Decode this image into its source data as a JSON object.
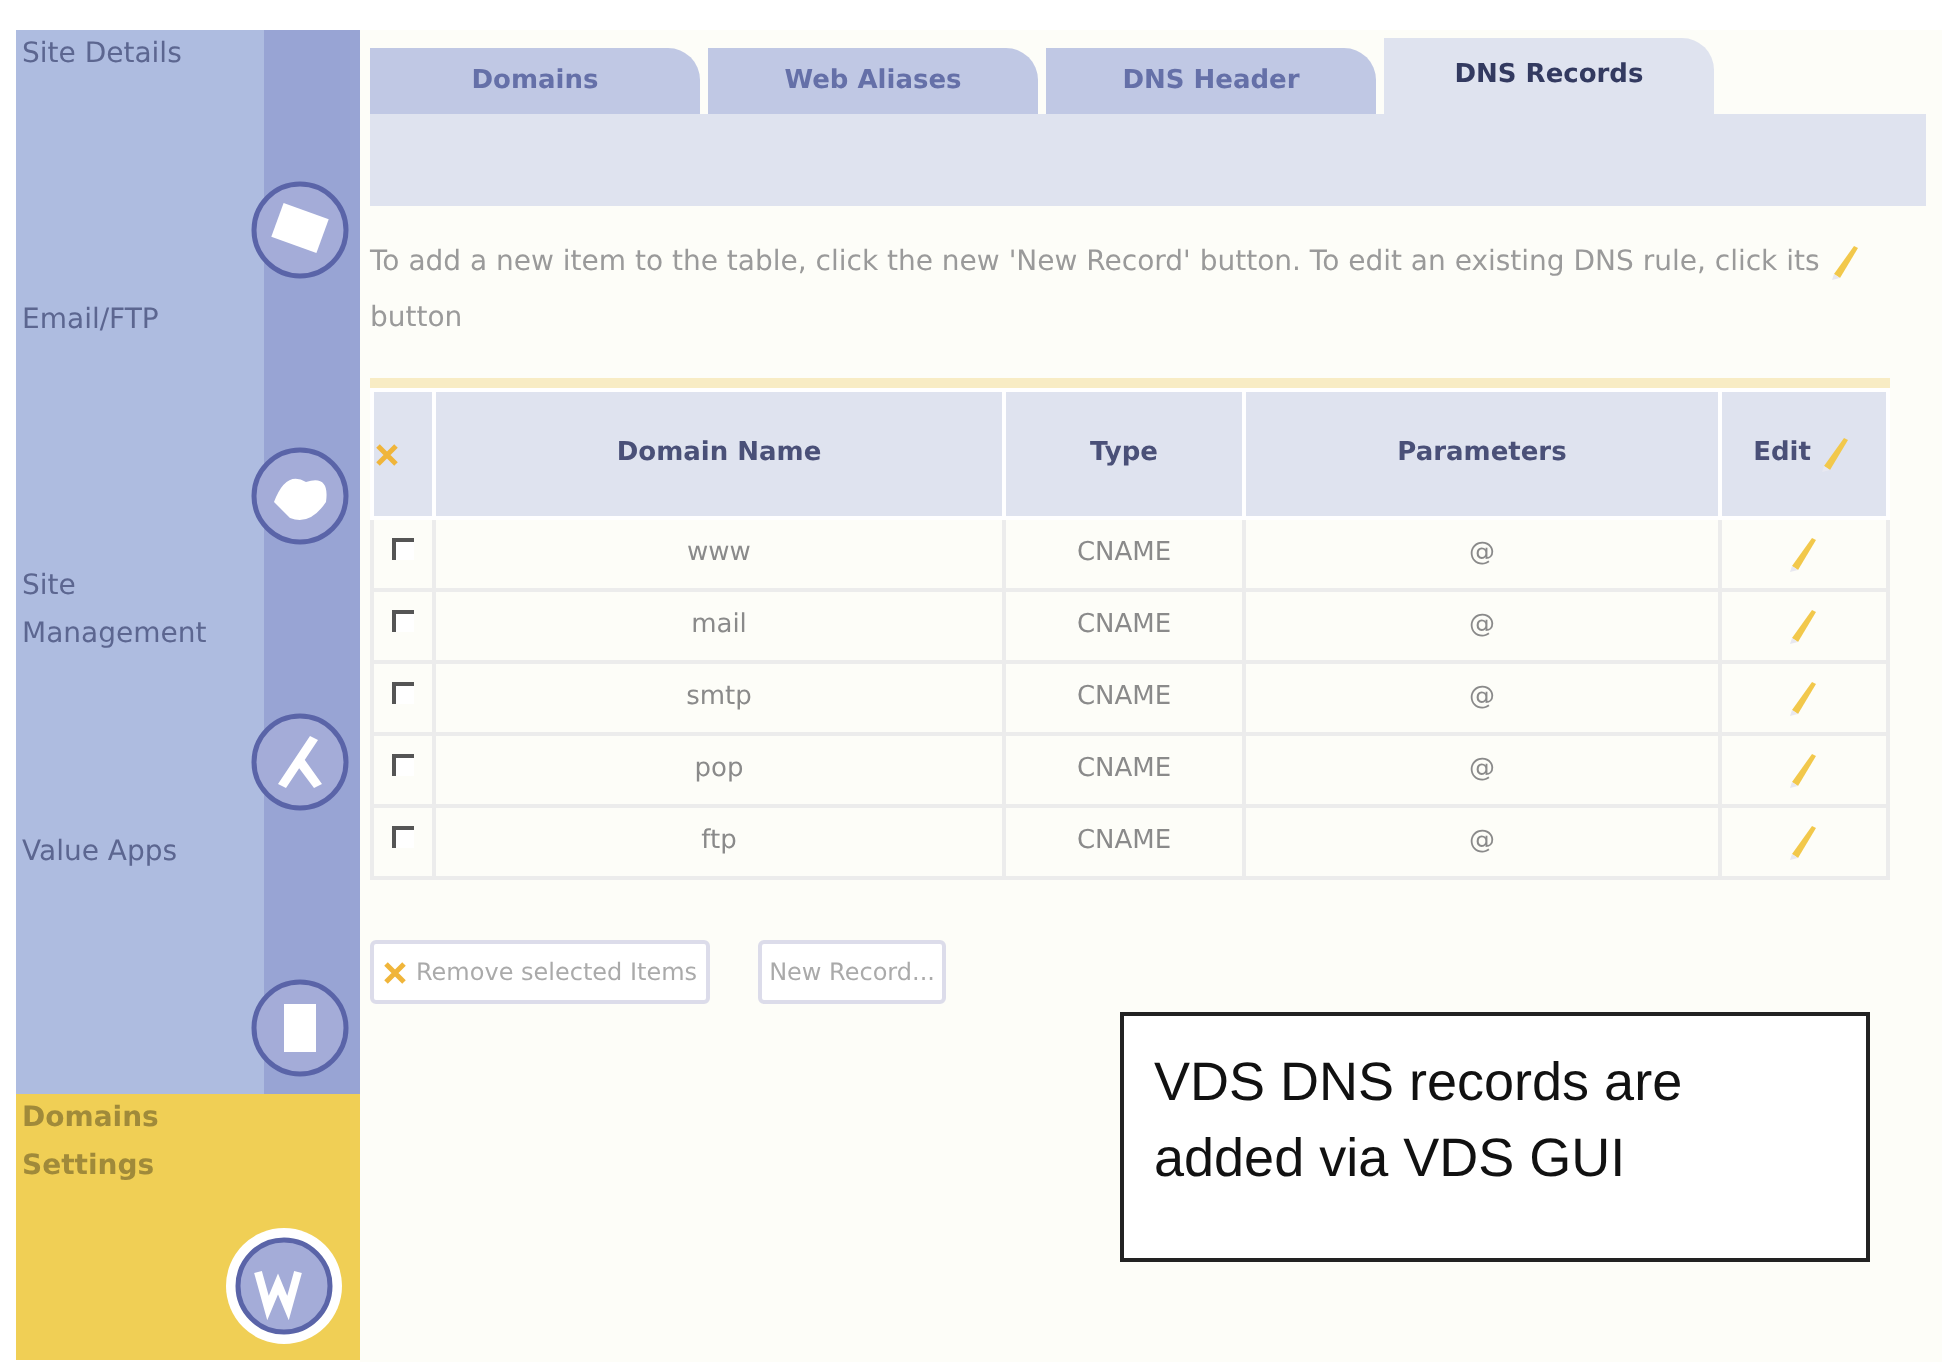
{
  "sidebar": {
    "items": [
      {
        "label": "Site Details",
        "selected": false
      },
      {
        "label": "Email/FTP",
        "selected": false
      },
      {
        "label": "Site Management",
        "selected": false
      },
      {
        "label": "Value Apps",
        "selected": false
      },
      {
        "label": "Domains Settings",
        "selected": true
      }
    ]
  },
  "tabs": [
    {
      "label": "Domains",
      "selected": false
    },
    {
      "label": "Web Aliases",
      "selected": false
    },
    {
      "label": "DNS Header",
      "selected": false
    },
    {
      "label": "DNS Records",
      "selected": true
    }
  ],
  "instructions": {
    "before": "To add a new item to the table, click the new 'New Record' button. To edit an existing DNS rule, click its",
    "after": "button"
  },
  "table": {
    "columns": [
      "Domain Name",
      "Type",
      "Parameters",
      "Edit"
    ],
    "rows": [
      {
        "domain": "www",
        "type": "CNAME",
        "parameters": "@",
        "checked": false
      },
      {
        "domain": "mail",
        "type": "CNAME",
        "parameters": "@",
        "checked": false
      },
      {
        "domain": "smtp",
        "type": "CNAME",
        "parameters": "@",
        "checked": false
      },
      {
        "domain": "pop",
        "type": "CNAME",
        "parameters": "@",
        "checked": false
      },
      {
        "domain": "ftp",
        "type": "CNAME",
        "parameters": "@",
        "checked": false
      }
    ]
  },
  "buttons": {
    "remove": "Remove selected Items",
    "new": "New Record..."
  },
  "callout": "VDS DNS records are added via VDS GUI"
}
